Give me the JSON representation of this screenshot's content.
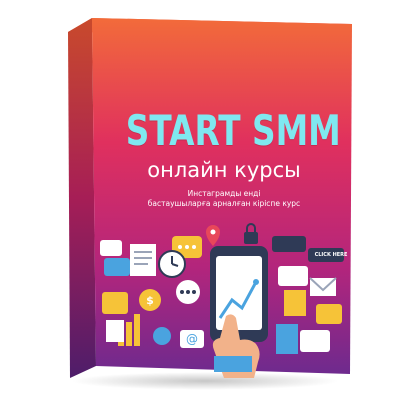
{
  "product": {
    "title": "START SMM",
    "subtitle": "онлайн курсы",
    "description_line1": "Инстаграмды енді",
    "description_line2": "бастаушыларға арналған кіріспе курс",
    "click_label": "CLICK HERE"
  },
  "colors": {
    "gradient_top": "#f0593c",
    "gradient_mid": "#d8246e",
    "gradient_bottom": "#7a2a8c",
    "title_color": "#7fe8f0",
    "accent_yellow": "#f6c338",
    "accent_blue": "#4aa3df"
  },
  "icons": [
    "message-bubble-icon",
    "clock-icon",
    "document-icon",
    "chart-icon",
    "phone-icon",
    "hand-pointer-icon",
    "lock-icon",
    "location-pin-icon",
    "mail-icon",
    "at-sign-icon",
    "bar-chart-icon",
    "like-icon",
    "cursor-icon"
  ]
}
